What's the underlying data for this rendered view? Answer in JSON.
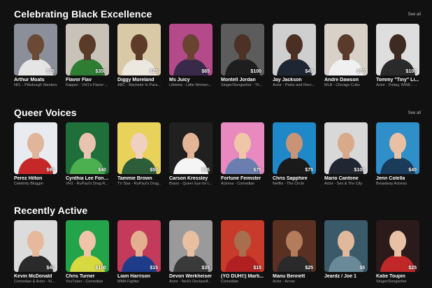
{
  "sections": [
    {
      "title": "Celebrating Black Excellence",
      "see_all": "See all",
      "cards": [
        {
          "name": "Arthur Moats",
          "sub": "NFL - Pittsburgh Steelers",
          "price": "$25",
          "bg": "#8a8f99",
          "skin": "#6b4a35",
          "shirt": "#e5e5e5"
        },
        {
          "name": "Flavor Flav",
          "sub": "Rapper - VH1's Flavor ...",
          "price": "$350",
          "bg": "#c9c2b8",
          "skin": "#5a3b2a",
          "shirt": "#2e7d32"
        },
        {
          "name": "Diggy Moreland",
          "sub": "ABC - Bachelor In Para...",
          "price": "$25",
          "bg": "#d9c9a6",
          "skin": "#5e3b28",
          "shirt": "#ece7df"
        },
        {
          "name": "Ms Juicy",
          "sub": "Lifetime - Little Women...",
          "price": "$65",
          "bg": "#b44a8a",
          "skin": "#6a4232",
          "shirt": "#3a2a4a"
        },
        {
          "name": "Montell Jordan",
          "sub": "Singer/Songwriter - Th...",
          "price": "$100",
          "bg": "#5c5c5c",
          "skin": "#4d3124",
          "shirt": "#1e1e1e"
        },
        {
          "name": "Jay Jackson",
          "sub": "Actor - Parks and Recr...",
          "price": "$49",
          "bg": "#cfcfcf",
          "skin": "#4b2f22",
          "shirt": "#1f2633"
        },
        {
          "name": "Andre Dawson",
          "sub": "MLB - Chicago Cubs",
          "price": "$70",
          "bg": "#d7d1c7",
          "skin": "#5a3a2a",
          "shirt": "#f0f0f0"
        },
        {
          "name": "Tommy \"Tiny\" Li...",
          "sub": "Actor - Friday, WWE - ...",
          "price": "$100",
          "bg": "#dedede",
          "skin": "#3e2a20",
          "shirt": "#2a2a2a"
        }
      ]
    },
    {
      "title": "Queer Voices",
      "see_all": "See all",
      "cards": [
        {
          "name": "Perez Hilton",
          "sub": "Celebrity Blogger",
          "price": "$90",
          "bg": "#e8ecf0",
          "skin": "#e0b59a",
          "shirt": "#c62828"
        },
        {
          "name": "Cynthia Lee Font...",
          "sub": "VH1 - RuPaul's Drag R...",
          "price": "$40",
          "bg": "#1f6f3a",
          "skin": "#e8c4b0",
          "shirt": "#4caf50"
        },
        {
          "name": "Tammie Brown",
          "sub": "TV Star - RuPaul's Drag...",
          "price": "$50",
          "bg": "#e8d25a",
          "skin": "#f0d0c0",
          "shirt": "#2e5d3a"
        },
        {
          "name": "Carson Kressley",
          "sub": "Bravo - Queer Eye for t...",
          "price": "$65",
          "bg": "#202020",
          "skin": "#e3b596",
          "shirt": "#f5f5f5"
        },
        {
          "name": "Fortune Feimster",
          "sub": "Actress - Comedian",
          "price": "$75",
          "bg": "#e88abf",
          "skin": "#f0c6a8",
          "shirt": "#6a7fb0"
        },
        {
          "name": "Chris Sapphire",
          "sub": "Netflix - The Circle",
          "price": "$75",
          "bg": "#1e88c8",
          "skin": "#c99476",
          "shirt": "#1a1a1a"
        },
        {
          "name": "Mario Cantone",
          "sub": "Actor - Sex & The City",
          "price": "$100",
          "bg": "#d8d8d8",
          "skin": "#d9aa8a",
          "shirt": "#202632"
        },
        {
          "name": "Jenn Colella",
          "sub": "Broadway Actress",
          "price": "$40",
          "bg": "#2f8fc9",
          "skin": "#eac0a4",
          "shirt": "#1b3b5a"
        }
      ]
    },
    {
      "title": "Recently Active",
      "see_all": "",
      "cards": [
        {
          "name": "Kevin McDonald",
          "sub": "Comedian & Actor - Ki...",
          "price": "$40",
          "bg": "#dcdcdc",
          "skin": "#e6b99c",
          "shirt": "#2a2a2a"
        },
        {
          "name": "Chris Turner",
          "sub": "YouTuber - Comedian",
          "price": "$100",
          "bg": "#23a34a",
          "skin": "#f0c4a8",
          "shirt": "#d8d840"
        },
        {
          "name": "Liam Harrison",
          "sub": "MMA Fighter",
          "price": "$15",
          "bg": "#c43a5a",
          "skin": "#e2b08e",
          "shirt": "#1e3c8a"
        },
        {
          "name": "Devon Werkheiser",
          "sub": "Actor - Ned's Declassif...",
          "price": "$35",
          "bg": "#9a9a9a",
          "skin": "#e8bfa0",
          "shirt": "#3a3a3a"
        },
        {
          "name": "(YO DUH!!) Marti...",
          "sub": "Comedian",
          "price": "$15",
          "bg": "#c83a2a",
          "skin": "#a86e4e",
          "shirt": "#b02020"
        },
        {
          "name": "Manu Bennett",
          "sub": "Actor - Arrow",
          "price": "$25",
          "bg": "#5a3022",
          "skin": "#b37c5c",
          "shirt": "#2a2a2a"
        },
        {
          "name": "Jeardz / Joe 1",
          "sub": "",
          "price": "$5",
          "bg": "#3a5a6a",
          "skin": "#e0b89c",
          "shirt": "#6a8a9a"
        },
        {
          "name": "Katie Toupin",
          "sub": "Singer/Songwriter",
          "price": "$25",
          "bg": "#2a1a1a",
          "skin": "#e8c0a6",
          "shirt": "#c02828"
        }
      ]
    }
  ]
}
